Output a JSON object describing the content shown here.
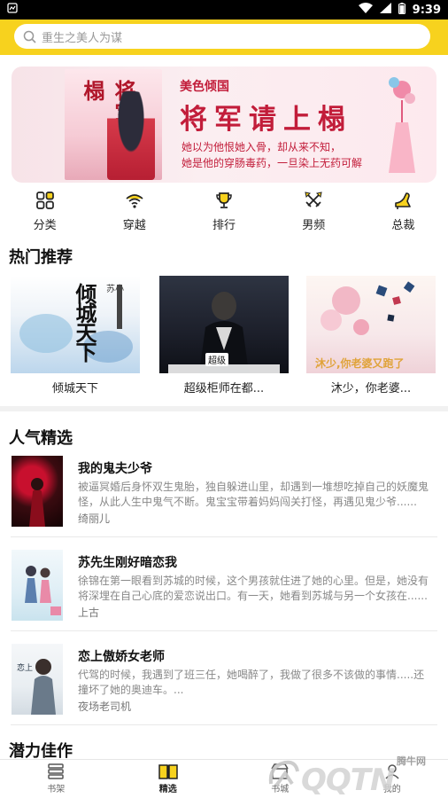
{
  "status_bar": {
    "time": "9:39"
  },
  "search": {
    "placeholder": "重生之美人为谋"
  },
  "banner": {
    "cover_title": "将军请上榻",
    "subtitle": "美色倾国",
    "title": "将军请上榻",
    "line1": "她以为他恨她入骨，却从来不知，",
    "line2": "她是他的穿肠毒药，一旦染上无药可解"
  },
  "categories": [
    {
      "label": "分类",
      "icon": "grid-icon"
    },
    {
      "label": "穿越",
      "icon": "wifi-icon"
    },
    {
      "label": "排行",
      "icon": "trophy-icon"
    },
    {
      "label": "男频",
      "icon": "swords-icon"
    },
    {
      "label": "总裁",
      "icon": "heel-icon"
    }
  ],
  "sections": {
    "hot": "热门推荐",
    "popular": "人气精选",
    "potential": "潜力佳作"
  },
  "hot_books": [
    {
      "name": "倾城天下",
      "cover_text": "倾城天下",
      "cover_author": "苏小",
      "colors": {
        "bg": "#eef3f8",
        "accent": "#2a6bb0"
      }
    },
    {
      "name": "超级柜师在都...",
      "cover_text": "超级",
      "colors": {
        "bg": "#1c1f2a",
        "accent": "#c9302c"
      }
    },
    {
      "name": "沐少，你老婆...",
      "cover_text": "沐少,你老婆又跑了",
      "colors": {
        "bg": "#f7e8ea",
        "accent": "#e0a33a"
      }
    }
  ],
  "popular_books": [
    {
      "title": "我的鬼夫少爷",
      "desc": "被逼冥婚后身怀双生鬼胎，独自躲进山里，却遇到一堆想吃掉自己的妖魔鬼怪，从此人生中鬼气不断。鬼宝宝带着妈妈闯关打怪，再遇见鬼少爷......",
      "author": "绮丽儿",
      "cover": {
        "bg": "#3a0b10",
        "accent": "#c8102e"
      }
    },
    {
      "title": "苏先生刚好暗恋我",
      "desc": "徐锦在第一眼看到苏城的时候，这个男孩就住进了她的心里。但是，她没有将深埋在自己心底的爱恋说出口。有一天，她看到苏城与另一个女孩在......",
      "author": "上古",
      "cover": {
        "bg": "#dfeef5",
        "accent": "#e98aa8"
      }
    },
    {
      "title": "恋上傲娇女老师",
      "desc": "代驾的时候，我遇到了班三任，她喝醉了，我做了很多不该做的事情.....还撞坏了她的奥迪车。...",
      "author": "夜场老司机",
      "cover": {
        "bg": "#e9eef2",
        "accent": "#6a7a8a"
      }
    }
  ],
  "bottom_nav": [
    {
      "label": "书架",
      "icon": "shelf-icon"
    },
    {
      "label": "精选",
      "icon": "book-open-icon"
    },
    {
      "label": "书城",
      "icon": "store-icon"
    },
    {
      "label": "我的",
      "icon": "user-icon"
    }
  ],
  "watermark": {
    "text1": "QQTN",
    "text2": "腾牛网"
  }
}
